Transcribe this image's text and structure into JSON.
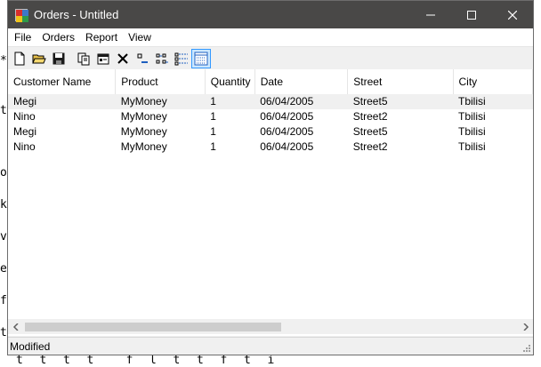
{
  "background": {
    "glyphs": [
      "*",
      "t",
      "o",
      "k",
      "v",
      "e",
      "f",
      "t"
    ],
    "bottom_text": "t  t  t  t    f  l  t  t  f  t  i"
  },
  "window": {
    "title": "Orders - Untitled",
    "icon": "app-icon",
    "buttons": [
      "minimize-icon",
      "maximize-icon",
      "close-icon"
    ]
  },
  "menu": [
    {
      "label": "File"
    },
    {
      "label": "Orders"
    },
    {
      "label": "Report"
    },
    {
      "label": "View"
    }
  ],
  "toolbar": [
    {
      "icon": "new-document-icon"
    },
    {
      "icon": "open-folder-icon"
    },
    {
      "icon": "save-icon"
    },
    {
      "icon": "copy-icon"
    },
    {
      "icon": "properties-icon"
    },
    {
      "icon": "delete-icon"
    },
    {
      "icon": "large-icons-view-icon"
    },
    {
      "icon": "small-icons-view-icon"
    },
    {
      "icon": "list-view-icon"
    },
    {
      "icon": "details-view-icon",
      "active": true
    }
  ],
  "table": {
    "columns": [
      "Customer Name",
      "Product",
      "Quantity",
      "Date",
      "Street",
      "City"
    ],
    "rows": [
      [
        "Megi",
        "MyMoney",
        "1",
        "06/04/2005",
        "Street5",
        "Tbilisi"
      ],
      [
        "Nino",
        "MyMoney",
        "1",
        "06/04/2005",
        "Street2",
        "Tbilisi"
      ],
      [
        "Megi",
        "MyMoney",
        "1",
        "06/04/2005",
        "Street5",
        "Tbilisi"
      ],
      [
        "Nino",
        "MyMoney",
        "1",
        "06/04/2005",
        "Street2",
        "Tbilisi"
      ]
    ],
    "selected_row": 0
  },
  "status": {
    "text": "Modified"
  },
  "colors": {
    "titlebar": "#494847",
    "selection": "#cce8ff",
    "accent": "#3399ff"
  }
}
